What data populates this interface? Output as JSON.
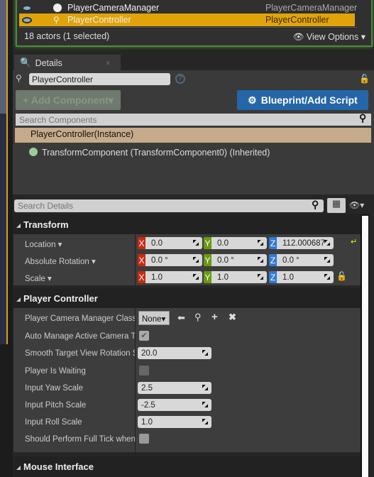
{
  "outliner": {
    "rows": [
      {
        "name": "PlayerCameraManager",
        "type": "PlayerCameraManager",
        "selected": false
      },
      {
        "name": "PlayerController",
        "type": "PlayerController",
        "selected": true
      }
    ],
    "footer": "18 actors (1 selected)",
    "view_options": "View Options"
  },
  "details": {
    "tab_label": "Details",
    "actor_name": "PlayerController",
    "add_component": "+ Add Component",
    "blueprint_button": "Blueprint/Add Script",
    "search_components_placeholder": "Search Components",
    "instance_row": "PlayerController(Instance)",
    "component_row": "TransformComponent (TransformComponent0) (Inherited)",
    "search_details_placeholder": "Search Details"
  },
  "transform": {
    "header": "Transform",
    "location": {
      "label": "Location",
      "x": "0.0",
      "y": "0.0",
      "z": "112.000687"
    },
    "rotation": {
      "label": "Absolute Rotation",
      "x": "0.0 °",
      "y": "0.0 °",
      "z": "0.0 °"
    },
    "scale": {
      "label": "Scale",
      "x": "1.0",
      "y": "1.0",
      "z": "1.0"
    }
  },
  "player_controller": {
    "header": "Player Controller",
    "camera_manager_class": {
      "label": "Player Camera Manager Class",
      "value": "None"
    },
    "auto_manage": {
      "label": "Auto Manage Active Camera Target",
      "checked": true
    },
    "smooth_rotation": {
      "label": "Smooth Target View Rotation Speed",
      "value": "20.0"
    },
    "player_waiting": {
      "label": "Player Is Waiting",
      "checked": false
    },
    "yaw": {
      "label": "Input Yaw Scale",
      "value": "2.5"
    },
    "pitch": {
      "label": "Input Pitch Scale",
      "value": "-2.5"
    },
    "roll": {
      "label": "Input Roll Scale",
      "value": "1.0"
    },
    "full_tick": {
      "label": "Should Perform Full Tick when Paused",
      "checked": false
    }
  },
  "mouse_interface": {
    "header": "Mouse Interface"
  },
  "colors": {
    "selected": "#e0a30a",
    "blueprint": "#2566a8",
    "instance": "#c6ab8a",
    "x": "#c92a10",
    "y": "#6a9a10",
    "z": "#2f7ad8"
  }
}
